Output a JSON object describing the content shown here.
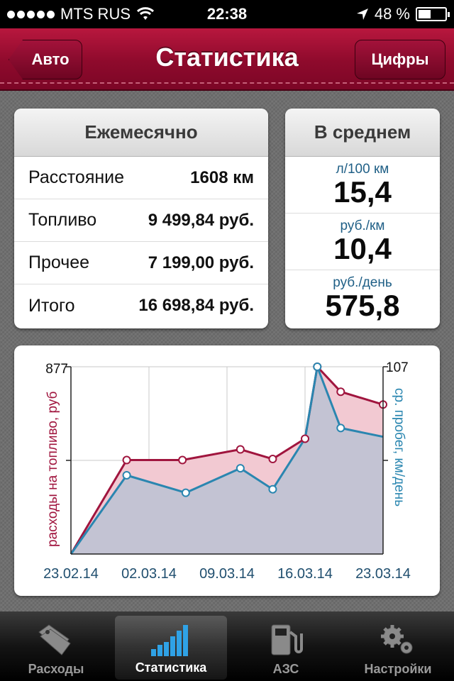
{
  "status_bar": {
    "carrier": "MTS RUS",
    "time": "22:38",
    "battery": "48 %",
    "battery_level": 0.48
  },
  "nav": {
    "back_label": "Авто",
    "title": "Статистика",
    "right_label": "Цифры"
  },
  "monthly": {
    "title": "Ежемесячно",
    "rows": [
      {
        "label": "Расстояние",
        "value": "1608 км"
      },
      {
        "label": "Топливо",
        "value": "9 499,84 руб."
      },
      {
        "label": "Прочее",
        "value": "7 199,00 руб."
      },
      {
        "label": "Итого",
        "value": "16 698,84 руб."
      }
    ]
  },
  "average": {
    "title": "В среднем",
    "rows": [
      {
        "unit": "л/100 км",
        "value": "15,4"
      },
      {
        "unit": "руб./км",
        "value": "10,4"
      },
      {
        "unit": "руб./день",
        "value": "575,8"
      }
    ]
  },
  "chart_data": {
    "type": "line",
    "x_ticks": [
      "23.02.14",
      "02.03.14",
      "09.03.14",
      "16.03.14",
      "23.03.14"
    ],
    "x_tick_days": [
      0,
      7,
      14,
      21,
      28
    ],
    "ylabel_left": "расходы на топливо, руб",
    "ylabel_right": "ср. пробег, км/день",
    "ylim_left": [
      0,
      877
    ],
    "ylim_right": [
      0,
      107
    ],
    "left_tick_labels": [
      "877"
    ],
    "right_tick_labels": [
      "107"
    ],
    "series": [
      {
        "axis": "left",
        "color": "#a0153e",
        "fill": "#f2c9d2",
        "points": [
          [
            0,
            0
          ],
          [
            5,
            440
          ],
          [
            10,
            440
          ],
          [
            15.2,
            490
          ],
          [
            18.1,
            445
          ],
          [
            21,
            540
          ],
          [
            22.1,
            877
          ],
          [
            24.2,
            760
          ],
          [
            28,
            700
          ]
        ]
      },
      {
        "axis": "right",
        "color": "#2a86b0",
        "fill": "#c3c3d3",
        "points": [
          [
            0,
            0
          ],
          [
            5,
            45
          ],
          [
            10.3,
            35
          ],
          [
            15.2,
            49
          ],
          [
            18.1,
            37
          ],
          [
            21,
            66
          ],
          [
            22.1,
            107
          ],
          [
            24.2,
            72
          ],
          [
            28,
            67
          ]
        ],
        "hollow_markers": [
          1,
          2,
          3,
          4,
          6,
          7
        ]
      }
    ],
    "grid": true
  },
  "tabs": [
    {
      "label": "Расходы",
      "icon": "tags-icon",
      "active": false
    },
    {
      "label": "Статистика",
      "icon": "bar-chart-icon",
      "active": true
    },
    {
      "label": "АЗС",
      "icon": "fuel-pump-icon",
      "active": false
    },
    {
      "label": "Настройки",
      "icon": "gears-icon",
      "active": false
    }
  ]
}
